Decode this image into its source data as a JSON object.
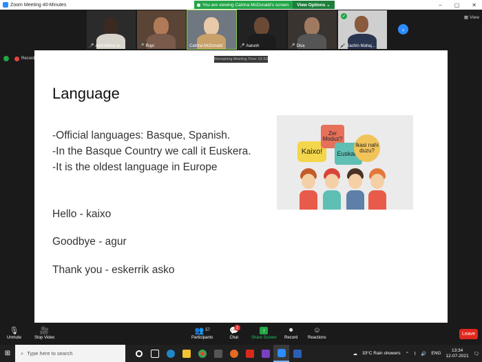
{
  "titlebar": {
    "title": "Zoom Meeting 40-Minutes",
    "minimize": "–",
    "maximize": "▢",
    "close": "✕"
  },
  "banner": {
    "text": "You are viewing Catrina McDonald's screen",
    "options_label": "View Options ⌄"
  },
  "participants": [
    {
      "name": "Avni Moms lo..."
    },
    {
      "name": "Rupi"
    },
    {
      "name": "Catrina McDonald"
    },
    {
      "name": "Aarush"
    },
    {
      "name": "Diva"
    },
    {
      "name": "Sachin Mahaj..."
    }
  ],
  "view_label": "View",
  "recording_label": "Recordi...",
  "meeting_timer": "Remaining Meeting Time: 01:53",
  "slide": {
    "title": "Language",
    "bullets": [
      "-Official languages: Basque, Spanish.",
      "-In the Basque Country we call it Euskera.",
      "-It is the oldest language in Europe"
    ],
    "phrases": [
      "Hello - kaixo",
      "Goodbye  - agur",
      "Thank you - eskerrik asko"
    ],
    "illustration_bubbles": [
      "Kaixo!",
      "Zer Moduz?",
      "Euskara",
      "Ikasi nahi duzu?"
    ]
  },
  "toolbar": {
    "unmute": "Unmute",
    "stop_video": "Stop Video",
    "participants": "Participants",
    "participants_count": "57",
    "chat": "Chat",
    "chat_badge": "2",
    "share_screen": "Share Screen",
    "record": "Record",
    "reactions": "Reactions",
    "leave": "Leave"
  },
  "taskbar": {
    "search_placeholder": "Type here to search",
    "weather": "33°C  Rain showers",
    "language": "ENG",
    "time": "13:34",
    "date": "12-07-2021"
  },
  "colors": {
    "accent": "#2d8cff",
    "share": "#23a548",
    "leave": "#e0271e"
  }
}
